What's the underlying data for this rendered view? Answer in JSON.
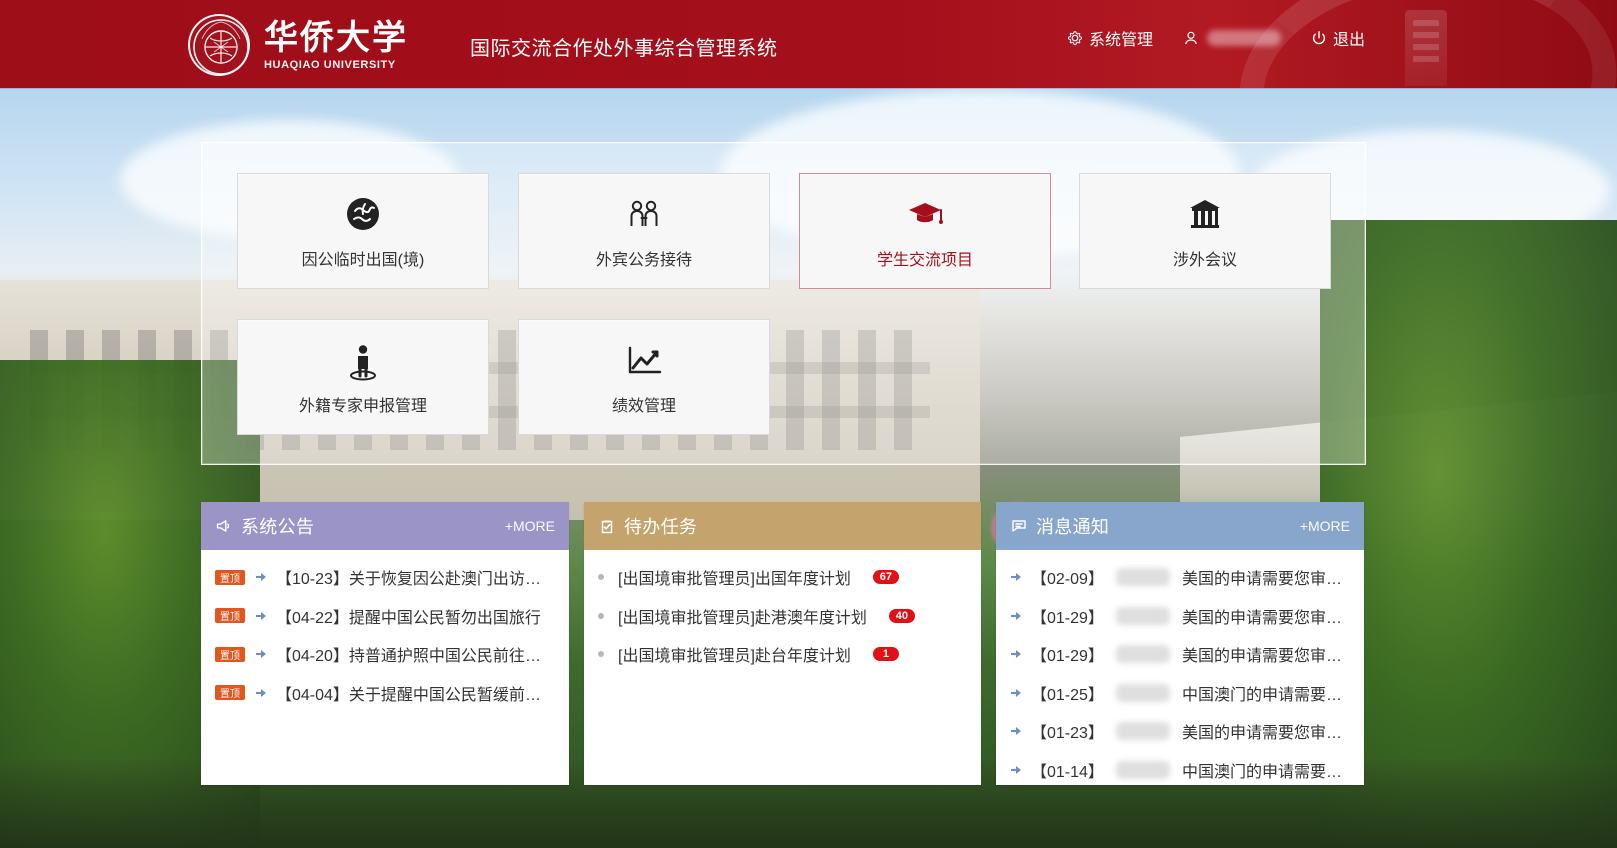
{
  "header": {
    "university_cn": "华侨大学",
    "university_en": "HUAQIAO UNIVERSITY",
    "system_title": "国际交流合作处外事综合管理系统",
    "actions": {
      "system_manage": "系统管理",
      "logout": "退出"
    }
  },
  "main": {
    "tiles": [
      {
        "label": "因公临时出国(境)",
        "icon": "globe-icon"
      },
      {
        "label": "外宾公务接待",
        "icon": "people-icon"
      },
      {
        "label": "学生交流项目",
        "icon": "graduation-cap-icon",
        "active": true
      },
      {
        "label": "涉外会议",
        "icon": "bank-icon"
      },
      {
        "label": "外籍专家申报管理",
        "icon": "person-pin-icon"
      },
      {
        "label": "绩效管理",
        "icon": "line-chart-icon"
      }
    ]
  },
  "widgets": {
    "announcements": {
      "title": "系统公告",
      "more": "+MORE",
      "color": "#9b94c6",
      "badge_label": "置顶",
      "items": [
        "【10-23】关于恢复因公赴澳门出访申…",
        "【04-22】提醒中国公民暂勿出国旅行",
        "【04-20】持普通护照中国公民前往有…",
        "【04-04】关于提醒中国公民暂缓前往…"
      ]
    },
    "todo": {
      "title": "待办任务",
      "color": "#c5a36d",
      "items": [
        {
          "text": "[出国境审批管理员]出国年度计划",
          "count": "67"
        },
        {
          "text": "[出国境审批管理员]赴港澳年度计划",
          "count": "40"
        },
        {
          "text": "[出国境审批管理员]赴台年度计划",
          "count": "1"
        }
      ]
    },
    "messages": {
      "title": "消息通知",
      "more": "+MORE",
      "color": "#88a5cb",
      "items": [
        {
          "date": "【02-09】",
          "suffix": "美国的申请需要您审批。"
        },
        {
          "date": "【01-29】",
          "suffix": "美国的申请需要您审批。"
        },
        {
          "date": "【01-29】",
          "suffix": "美国的申请需要您审批。"
        },
        {
          "date": "【01-25】",
          "suffix": "中国澳门的申请需要您审批。"
        },
        {
          "date": "【01-23】",
          "suffix": "美国的申请需要您审批。"
        },
        {
          "date": "【01-14】",
          "suffix": "中国澳门的申请需要您审…"
        }
      ]
    }
  }
}
